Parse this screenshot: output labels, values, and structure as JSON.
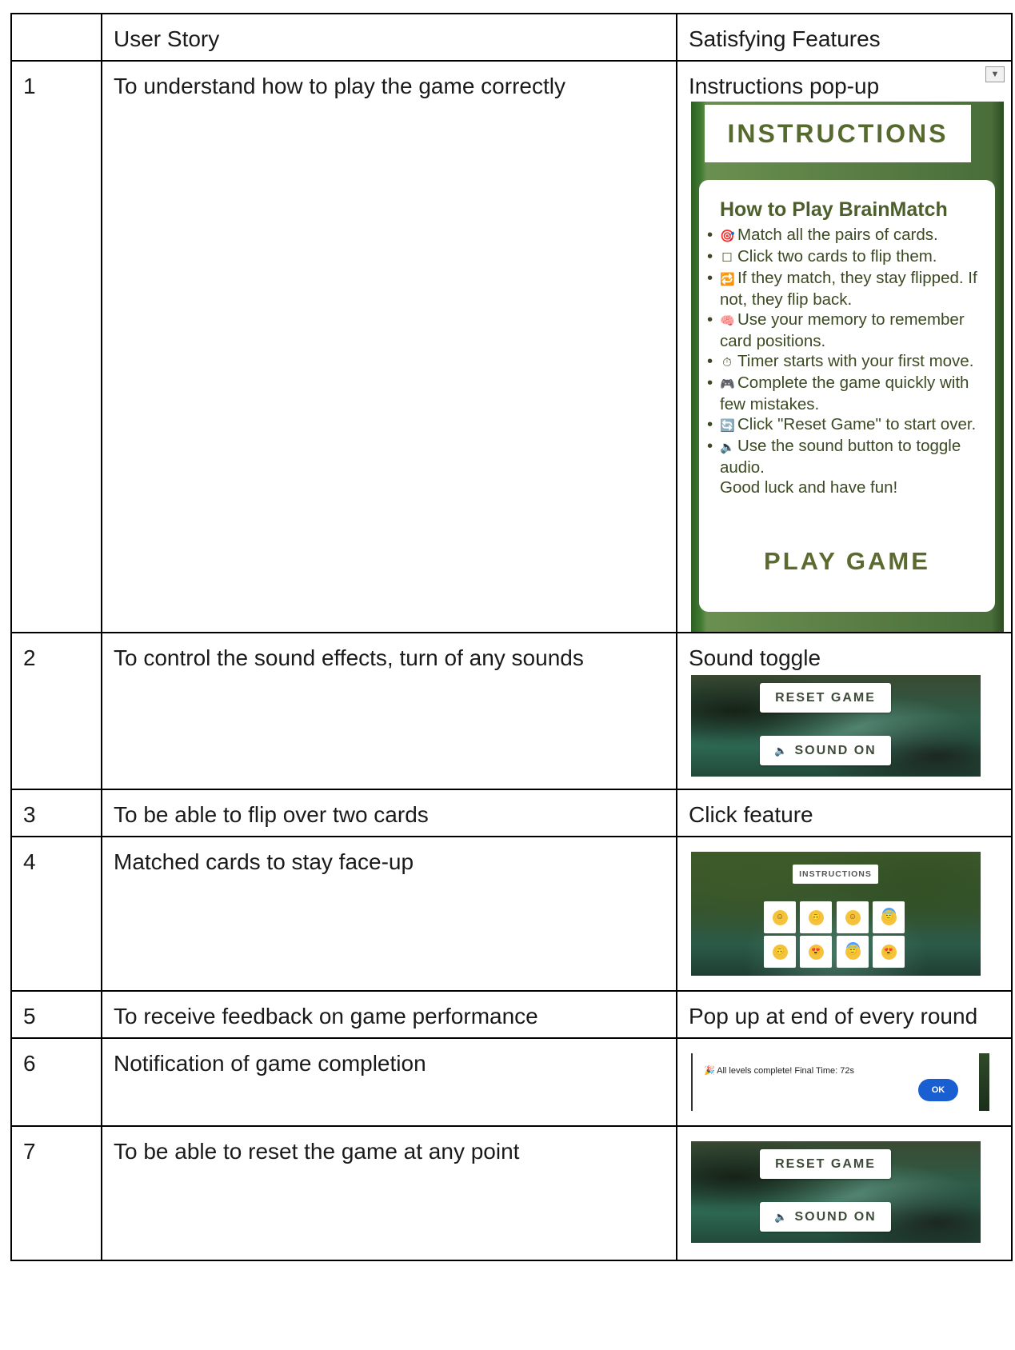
{
  "table": {
    "header": {
      "num": "",
      "story": "User Story",
      "features": "Satisfying Features"
    },
    "rows": [
      {
        "num": "1",
        "story": "To understand how to play the game correctly",
        "feature": "Instructions pop-up"
      },
      {
        "num": "2",
        "story": "To control the sound effects, turn of any sounds",
        "feature": "Sound toggle"
      },
      {
        "num": "3",
        "story": "To be able to flip over two cards",
        "feature": "Click feature"
      },
      {
        "num": "4",
        "story": "Matched cards to stay face-up",
        "feature": ""
      },
      {
        "num": "5",
        "story": "To receive feedback on game performance",
        "feature": "Pop up at end of every round"
      },
      {
        "num": "6",
        "story": "Notification of game completion",
        "feature": ""
      },
      {
        "num": "7",
        "story": "To be able to reset the game at any point",
        "feature": ""
      }
    ]
  },
  "instructions_popup": {
    "title": "INSTRUCTIONS",
    "heading": "How to Play BrainMatch",
    "items": [
      {
        "icon": "🎯",
        "text": "Match all the pairs of cards."
      },
      {
        "icon": "☐",
        "text": "Click two cards to flip them."
      },
      {
        "icon": "🔁",
        "text": "If they match, they stay flipped. If not, they flip back."
      },
      {
        "icon": "🧠",
        "text": "Use your memory to remember card positions."
      },
      {
        "icon": "⏱",
        "text": "Timer starts with your first move."
      },
      {
        "icon": "🎮",
        "text": "Complete the game quickly with few mistakes."
      },
      {
        "icon": "🔄",
        "text": "Click \"Reset Game\" to start over."
      },
      {
        "icon": "🔈",
        "text": "Use the sound button to toggle audio."
      }
    ],
    "closing": "Good luck and have fun!",
    "play_button": "PLAY GAME"
  },
  "controls": {
    "reset_label": "RESET GAME",
    "sound_label": "SOUND ON",
    "sound_icon": "🔈"
  },
  "grid": {
    "instructions_label": "INSTRUCTIONS",
    "cards": [
      "☺",
      "🙃",
      "☺",
      "😇",
      "🙃",
      "😍",
      "😇",
      "😍"
    ]
  },
  "completion": {
    "icon": "🎉",
    "message": "All levels complete! Final Time: 72s",
    "ok_label": "OK"
  }
}
